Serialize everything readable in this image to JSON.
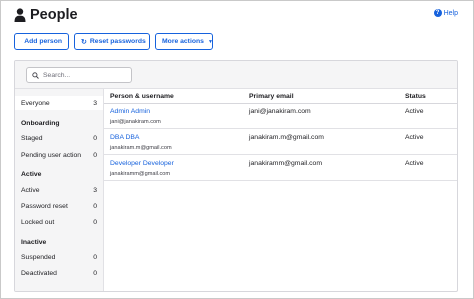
{
  "header": {
    "title": "People",
    "help_label": "Help"
  },
  "toolbar": {
    "add_person": "Add person",
    "reset_passwords": "Reset passwords",
    "more_actions": "More actions"
  },
  "search": {
    "placeholder": "Search..."
  },
  "sidebar": {
    "everyone": {
      "label": "Everyone",
      "count": "3"
    },
    "onboarding_heading": "Onboarding",
    "staged": {
      "label": "Staged",
      "count": "0"
    },
    "pending": {
      "label": "Pending user action",
      "count": "0"
    },
    "active_heading": "Active",
    "active": {
      "label": "Active",
      "count": "3"
    },
    "password_reset": {
      "label": "Password reset",
      "count": "0"
    },
    "locked_out": {
      "label": "Locked out",
      "count": "0"
    },
    "inactive_heading": "Inactive",
    "suspended": {
      "label": "Suspended",
      "count": "0"
    },
    "deactivated": {
      "label": "Deactivated",
      "count": "0"
    }
  },
  "table": {
    "columns": [
      "Person & username",
      "Primary email",
      "Status"
    ],
    "rows": [
      {
        "name": "Admin Admin",
        "username": "jani@janakiram.com",
        "email": "jani@janakiram.com",
        "status": "Active"
      },
      {
        "name": "DBA DBA",
        "username": "janakiram.m@gmail.com",
        "email": "janakiram.m@gmail.com",
        "status": "Active"
      },
      {
        "name": "Developer Developer",
        "username": "janakiramm@gmail.com",
        "email": "janakiramm@gmail.com",
        "status": "Active"
      }
    ]
  },
  "colors": {
    "accent": "#1662dd",
    "sidebar_bg": "#f5f5f6",
    "text": "#1d1d21"
  },
  "icons": {
    "title": "person-icon",
    "help": "help-circle-icon",
    "add_person": "add-person-icon",
    "reset": "refresh-icon",
    "more": "chevron-down-icon",
    "search": "search-icon"
  }
}
